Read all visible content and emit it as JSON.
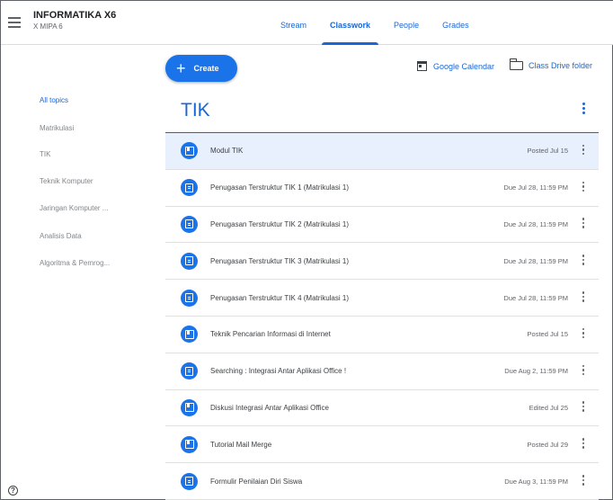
{
  "header": {
    "class_name": "INFORMATIKA X6",
    "section": "X MIPA 6",
    "tabs": [
      {
        "label": "Stream"
      },
      {
        "label": "Classwork"
      },
      {
        "label": "People"
      },
      {
        "label": "Grades"
      }
    ],
    "active_tab": "Classwork"
  },
  "toolbar": {
    "create_label": "Create",
    "create_icon": "+",
    "calendar_label": "Google Calendar",
    "drive_label": "Class Drive folder"
  },
  "sidebar": {
    "items": [
      {
        "label": "All topics",
        "active": true
      },
      {
        "label": "Matrikulasi"
      },
      {
        "label": "TIK"
      },
      {
        "label": "Teknik Komputer"
      },
      {
        "label": "Jaringan Komputer ..."
      },
      {
        "label": "Analisis Data"
      },
      {
        "label": "Algoritma & Pemrog..."
      }
    ]
  },
  "topic": {
    "title": "TIK"
  },
  "items": [
    {
      "title": "Modul TIK",
      "meta": "Posted Jul 15",
      "icon": "material-book-icon",
      "selected": true
    },
    {
      "title": "Penugasan Terstruktur TIK 1 (Matrikulasi 1)",
      "meta": "Due Jul 28, 11:59 PM",
      "icon": "assignment-icon"
    },
    {
      "title": "Penugasan Terstruktur TIK 2 (Matrikulasi 1)",
      "meta": "Due Jul 28, 11:59 PM",
      "icon": "assignment-icon"
    },
    {
      "title": "Penugasan Terstruktur TIK 3 (Matrikulasi 1)",
      "meta": "Due Jul 28, 11:59 PM",
      "icon": "assignment-icon"
    },
    {
      "title": "Penugasan Terstruktur TIK 4 (Matrikulasi 1)",
      "meta": "Due Jul 28, 11:59 PM",
      "icon": "assignment-icon"
    },
    {
      "title": "Teknik Pencarian Informasi di Internet",
      "meta": "Posted Jul 15",
      "icon": "material-book-icon"
    },
    {
      "title": "Searching : Integrasi Antar Aplikasi Office !",
      "meta": "Due Aug 2, 11:59 PM",
      "icon": "assignment-icon"
    },
    {
      "title": "Diskusi Integrasi Antar Aplikasi Office",
      "meta": "Edited Jul 25",
      "icon": "material-book-icon"
    },
    {
      "title": "Tutorial Mail Merge",
      "meta": "Posted Jul 29",
      "icon": "material-book-icon"
    },
    {
      "title": "Formulir Penilaian Diri Siswa",
      "meta": "Due Aug 3, 11:59 PM",
      "icon": "assignment-icon"
    }
  ],
  "colors": {
    "accent": "#1a73e8",
    "link": "#1967d2",
    "selected_row": "#e8f0fe"
  }
}
